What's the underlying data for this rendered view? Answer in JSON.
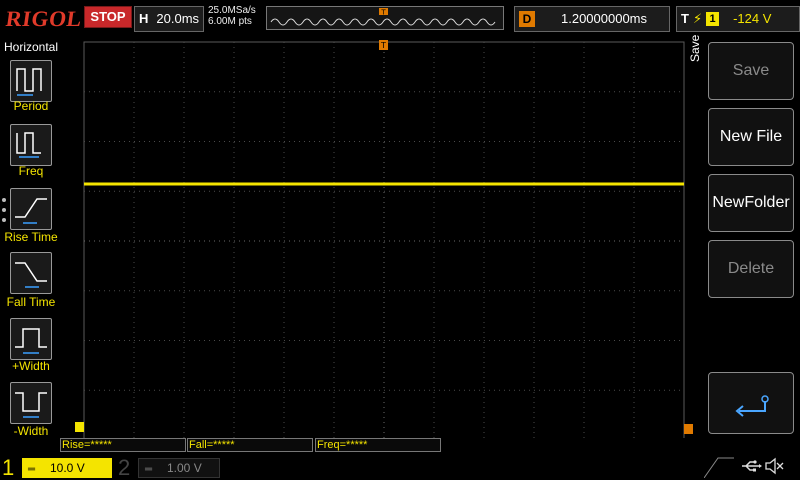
{
  "header": {
    "logo": "RIGOL",
    "run_state": "STOP",
    "timebase_key": "H",
    "timebase_value": "20.0ms",
    "sample_rate": "25.0MSa/s",
    "memory_depth": "6.00M pts",
    "delay_key": "D",
    "delay_value": "1.20000000ms",
    "trigger_key": "T",
    "trigger_source": "1",
    "trigger_level": "-124 V"
  },
  "left_menu": {
    "title": "Horizontal",
    "items": [
      {
        "label": "Period",
        "icon": "period-icon"
      },
      {
        "label": "Freq",
        "icon": "frequency-icon"
      },
      {
        "label": "Rise Time",
        "icon": "rise-time-icon"
      },
      {
        "label": "Fall Time",
        "icon": "fall-time-icon"
      },
      {
        "label": "+Width",
        "icon": "positive-width-icon"
      },
      {
        "label": "-Width",
        "icon": "negative-width-icon"
      }
    ]
  },
  "right_menu": {
    "title": "Save",
    "keys": [
      {
        "label": "Save",
        "enabled": false
      },
      {
        "label": "New File",
        "enabled": true
      },
      {
        "label": "NewFolder",
        "enabled": true
      },
      {
        "label": "Delete",
        "enabled": false
      }
    ],
    "return_icon": "return-arrow-icon"
  },
  "measurements": [
    {
      "label": "Rise=*****"
    },
    {
      "label": "Fall=*****"
    },
    {
      "label": "Freq=*****"
    }
  ],
  "channels": {
    "ch1": {
      "number": "1",
      "scale": "10.0 V",
      "color": "#f4e400"
    },
    "ch2": {
      "number": "2",
      "scale": "1.00 V",
      "color": "#444444"
    }
  },
  "status_icons": [
    "usb-icon",
    "mute-speaker-icon"
  ],
  "colors": {
    "accent": "#f4e400",
    "stop": "#c8282a",
    "delay_marker": "#e07a00"
  }
}
